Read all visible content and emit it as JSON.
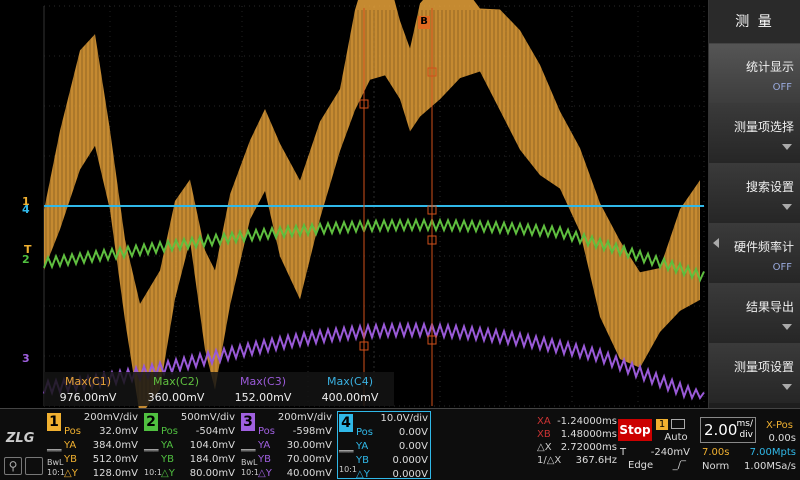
{
  "menu": {
    "title": "测 量",
    "items": [
      {
        "label": "统计显示",
        "sub": "OFF",
        "active": true
      },
      {
        "label": "测量项选择",
        "sub": ""
      },
      {
        "label": "搜索设置",
        "sub": ""
      },
      {
        "label": "硬件频率计",
        "sub": "OFF"
      },
      {
        "label": "结果导出",
        "sub": ""
      },
      {
        "label": "测量项设置",
        "sub": ""
      }
    ]
  },
  "measurements": [
    {
      "label": "Max(C1)",
      "value": "976.00mV",
      "color": "#e8a23a"
    },
    {
      "label": "Max(C2)",
      "value": "360.00mV",
      "color": "#5fbf3f"
    },
    {
      "label": "Max(C3)",
      "value": "152.00mV",
      "color": "#9a5ad8"
    },
    {
      "label": "Max(C4)",
      "value": "400.00mV",
      "color": "#3ab0e0"
    }
  ],
  "markers": {
    "ch1": "1",
    "ch4": "4",
    "ch2": "2",
    "ch3": "3",
    "trigger": "T",
    "cursor_b": "B"
  },
  "channels": [
    {
      "num": "1",
      "color": "#f0b030",
      "div": "200mV/div",
      "pos": "32.0mV",
      "ya": "384.0mV",
      "yb": "512.0mV",
      "dy": "128.0mV"
    },
    {
      "num": "2",
      "color": "#50c040",
      "div": "500mV/div",
      "pos": "-504mV",
      "ya": "104.0mV",
      "yb": "184.0mV",
      "dy": "80.00mV"
    },
    {
      "num": "3",
      "color": "#a060e0",
      "div": "200mV/div",
      "pos": "-598mV",
      "ya": "30.00mV",
      "yb": "70.00mV",
      "dy": "40.00mV"
    },
    {
      "num": "4",
      "color": "#30b8e8",
      "div": "10.0V/div",
      "pos": "0.00V",
      "ya": "0.00V",
      "yb": "0.000V",
      "dy": "0.000V"
    }
  ],
  "channel_keys": {
    "pos": "Pos",
    "ya": "YA",
    "yb": "YB",
    "dy": "△Y",
    "bwl": "BwL",
    "probe": "10:1"
  },
  "cursors": {
    "xa_label": "XA",
    "xa": "-1.24000ms",
    "xb_label": "XB",
    "xb": "1.48000ms",
    "dx_label": "△X",
    "dx": "2.72000ms",
    "inv_label": "1/△X",
    "inv": "367.6Hz"
  },
  "run_state": "Stop",
  "trigger": {
    "mode_num": "1",
    "mode": "Auto",
    "level_label": "T",
    "level": "-240mV",
    "type": "Edge"
  },
  "timebase": {
    "value": "2.00",
    "unit_top": "ms/",
    "unit_bot": "div",
    "xpos_label": "X-Pos",
    "xpos": "0.00s",
    "record": "7.00s",
    "mpts": "7.00Mpts",
    "acq": "Norm",
    "rate": "1.00MSa/s"
  },
  "logo": "ZLG"
}
